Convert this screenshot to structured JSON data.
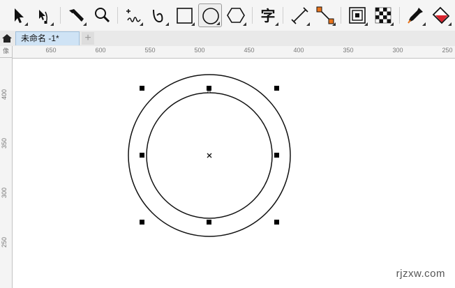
{
  "toolbar": {
    "tools": [
      {
        "name": "pick-tool",
        "icon": "arrow-pointer-icon",
        "active": false
      },
      {
        "name": "shape-tool",
        "icon": "shape-node-icon",
        "active": false
      },
      {
        "name": "crop-tool",
        "icon": "knife-icon",
        "active": false
      },
      {
        "name": "zoom-tool",
        "icon": "magnifier-icon",
        "active": false
      },
      {
        "name": "freehand-tool",
        "icon": "freehand-icon",
        "active": false
      },
      {
        "name": "artistic-media-tool",
        "icon": "curve-icon",
        "active": false
      },
      {
        "name": "rectangle-tool",
        "icon": "rectangle-icon",
        "active": false
      },
      {
        "name": "ellipse-tool",
        "icon": "ellipse-icon",
        "active": true
      },
      {
        "name": "polygon-tool",
        "icon": "hexagon-icon",
        "active": false
      },
      {
        "name": "text-tool",
        "icon": "text-char-icon",
        "label": "字",
        "active": false
      },
      {
        "name": "dimension-tool",
        "icon": "parallel-line-icon",
        "active": false
      },
      {
        "name": "connector-tool",
        "icon": "connector-icon",
        "active": false
      },
      {
        "name": "contour-tool",
        "icon": "contour-icon",
        "active": false
      },
      {
        "name": "transparency-tool",
        "icon": "checkerboard-icon",
        "active": false
      },
      {
        "name": "eyedropper-tool",
        "icon": "eyedropper-icon",
        "active": false
      },
      {
        "name": "fill-tool",
        "icon": "paint-bucket-icon",
        "active": false
      }
    ]
  },
  "tabs": {
    "document_title": "未命名 -1*",
    "add_label": "+"
  },
  "rulers": {
    "unit_label": "像",
    "horizontal": [
      "650",
      "600",
      "550",
      "500",
      "450",
      "400",
      "350",
      "300",
      "250"
    ],
    "vertical": [
      "400",
      "350",
      "300",
      "250"
    ]
  },
  "colors": {
    "accent": "#cfe3f5",
    "fill_icon_red": "#d9232d",
    "connector_orange": "#e8741c"
  },
  "watermark": "rjzxw.com"
}
